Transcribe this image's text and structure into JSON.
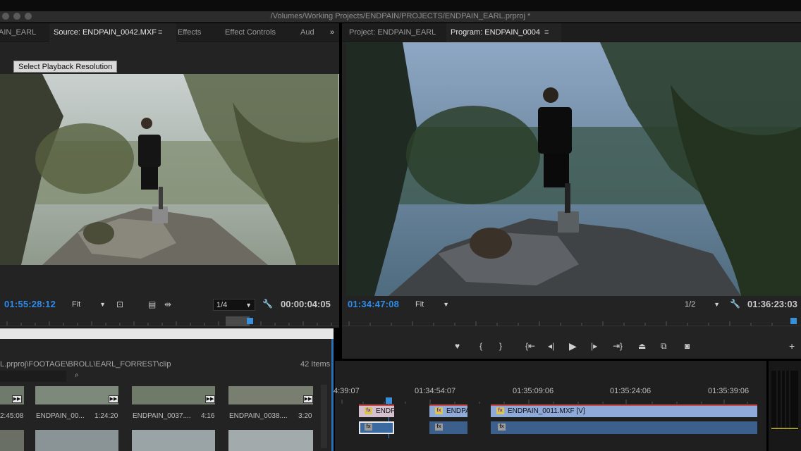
{
  "window": {
    "title": "/Volumes/Working Projects/ENDPAIN/PROJECTS/ENDPAIN_EARL.prproj *"
  },
  "source_panel": {
    "tabs": [
      {
        "label": "AIN_EARL"
      },
      {
        "label": "Source: ENDPAIN_0042.MXF"
      },
      {
        "label": "Effects"
      },
      {
        "label": "Effect Controls"
      },
      {
        "label": "Aud"
      }
    ],
    "overflow": "»",
    "tooltip": "Select Playback Resolution",
    "timecode": "01:55:28:12",
    "zoom": "Fit",
    "resolution": "1/4",
    "duration": "00:00:04:05"
  },
  "program_panel": {
    "tabs": [
      {
        "label": "Project: ENDPAIN_EARL"
      },
      {
        "label": "Program: ENDPAIN_0004"
      }
    ],
    "timecode": "01:34:47:08",
    "zoom": "Fit",
    "resolution": "1/2",
    "duration": "01:36:23:03"
  },
  "bin": {
    "path": "L.prproj\\FOOTAGE\\BROLL\\EARL_FORREST\\clip",
    "item_count": "42 Items",
    "items": [
      {
        "name": "",
        "duration": "2:45:08"
      },
      {
        "name": "ENDPAIN_00...",
        "duration": "1:24:20"
      },
      {
        "name": "ENDPAIN_0037....",
        "duration": "4:16"
      },
      {
        "name": "ENDPAIN_0038....",
        "duration": "3:20"
      }
    ]
  },
  "timeline": {
    "ruler": [
      "4:39:07",
      "01:34:54:07",
      "01:35:09:06",
      "01:35:24:06",
      "01:35:39:06"
    ],
    "clips": [
      {
        "label": "ENDF"
      },
      {
        "label": "ENDPA"
      },
      {
        "label": "ENDPAIN_0011.MXF [V]"
      }
    ]
  },
  "colors": {
    "accent": "#2d8ceb",
    "panel_bg": "#232323",
    "clip_video": "#8fa9d8",
    "clip_audio": "#3d5f8c"
  }
}
